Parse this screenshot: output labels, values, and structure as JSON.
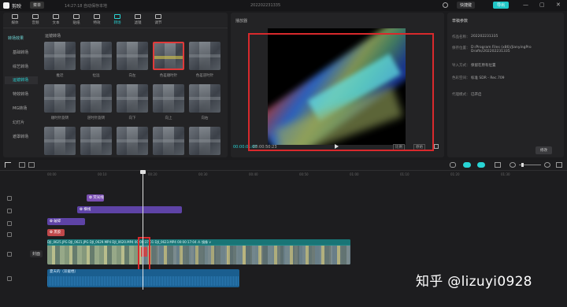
{
  "titlebar": {
    "app_name": "剪映",
    "menu_label": "菜单",
    "autosave": "14:27:18 自动保存本地",
    "project": "202202231335",
    "shortcut": "快捷键",
    "export": "导出",
    "win_min": "—",
    "win_max": "▢",
    "win_close": "✕"
  },
  "toolbar": {
    "items": [
      {
        "label": "媒体"
      },
      {
        "label": "音频"
      },
      {
        "label": "文本"
      },
      {
        "label": "贴纸"
      },
      {
        "label": "特效"
      },
      {
        "label": "转场"
      },
      {
        "label": "滤镜"
      },
      {
        "label": "调节"
      }
    ],
    "active_index": 5
  },
  "categories": {
    "header": "转场效果",
    "items": [
      {
        "label": "基础转场"
      },
      {
        "label": "综艺转场"
      },
      {
        "label": "运镜转场"
      },
      {
        "label": "特效转场"
      },
      {
        "label": "MG转场"
      },
      {
        "label": "幻灯片"
      },
      {
        "label": "遮罩转场"
      }
    ],
    "active_index": 2
  },
  "grid": {
    "title": "运镜转场",
    "thumbnails": [
      {
        "label": "推近"
      },
      {
        "label": "拉远"
      },
      {
        "label": "向左"
      },
      {
        "label": "色差顺时针"
      },
      {
        "label": "色差逆时针"
      },
      {
        "label": "顺时针旋转"
      },
      {
        "label": "逆时针旋转"
      },
      {
        "label": "向下"
      },
      {
        "label": "向上"
      },
      {
        "label": "向右"
      },
      {
        "label": ""
      },
      {
        "label": ""
      },
      {
        "label": ""
      },
      {
        "label": ""
      },
      {
        "label": ""
      }
    ],
    "selected_index": 3
  },
  "player": {
    "title": "播放器",
    "timecode": "00:00:01:07",
    "duration": "00:00:50:23",
    "ratio_label": "比例",
    "original_label": "原始"
  },
  "props": {
    "title": "草稿参数",
    "rows": [
      {
        "key": "作品名称：",
        "value": "202202231335"
      },
      {
        "key": "保存位置：",
        "value": "D:/Program Files (x86)/JianyingPro Drafts/202202231335"
      },
      {
        "key": "导入方式：",
        "value": "保留在原有位置"
      },
      {
        "key": "色彩空间：",
        "value": "标准 SDR - Rec.709"
      },
      {
        "key": "代理模式：",
        "value": "已开启"
      }
    ],
    "modify": "修改"
  },
  "timeline": {
    "ticks": [
      "00:00",
      "00:10",
      "00:20",
      "00:30",
      "00:40",
      "00:50",
      "01:00",
      "01:10",
      "01:20",
      "01:30"
    ],
    "clips": {
      "effect1": "❂ 荧光线",
      "effect2": "❂ 横线",
      "effect3": "❂ 破碎",
      "filter1": "❂ 黑胶",
      "main_header": "DJI_0625.JPG    DJI_0621.JPG   DJI_0629.MP4    DJI_0620.MP4  00:00:37:01   DJI_0623.MP4   00:00:17:04   ⁂ 镜像 ⋎",
      "audio_header": "夏天的（双截棍）"
    },
    "cover_label": "封面"
  },
  "watermark": "知乎 @lizuyi0928",
  "colors": {
    "accent": "#28d4d4",
    "highlight_box": "#d8292c",
    "effect_clip": "#7b4fb3",
    "filter_clip": "#c0484a",
    "main_clip": "#1f8a8a",
    "audio_clip": "#1a5e8f"
  }
}
